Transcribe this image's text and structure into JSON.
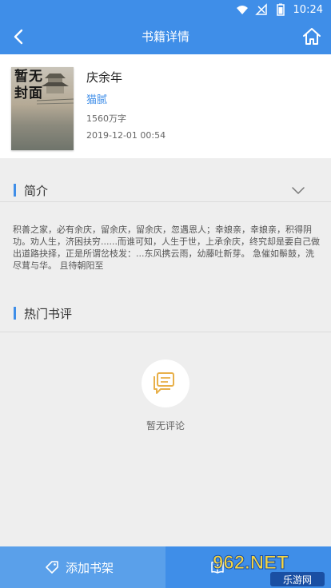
{
  "status_bar": {
    "time": "10:24"
  },
  "header": {
    "title": "书籍详情"
  },
  "book": {
    "cover_text": "暂无封面",
    "title": "庆余年",
    "author": "猫腻",
    "word_count": "1560万字",
    "updated": "2019-12-01 00:54"
  },
  "intro": {
    "label": "简介",
    "text": "积善之家，必有余庆，留余庆，留余庆，忽遇恩人；幸娘亲，幸娘亲，积得阴功。劝人生，济困扶穷......而谁可知，人生于世，上承余庆，终究却是要自己做出道路抉择，正是所谓岔枝发：...东风携云雨，幼藤吐新芽。  急催如鬃鼓，洗尽茸与华。  且待朝阳至"
  },
  "reviews": {
    "label": "热门书评",
    "empty_text": "暂无评论"
  },
  "bottom": {
    "add_shelf_label": "添加书架"
  },
  "watermark": {
    "brand": "962.NET",
    "sub": "乐游网"
  },
  "colors": {
    "primary": "#3f8ee8",
    "secondary": "#5aa0ea",
    "empty_icon": "#e8b04a"
  },
  "icons": [
    "wifi-icon",
    "signal-icon",
    "battery-icon",
    "back-arrow-icon",
    "home-icon",
    "chevron-down-icon",
    "comment-icon",
    "tag-icon",
    "book-icon"
  ]
}
